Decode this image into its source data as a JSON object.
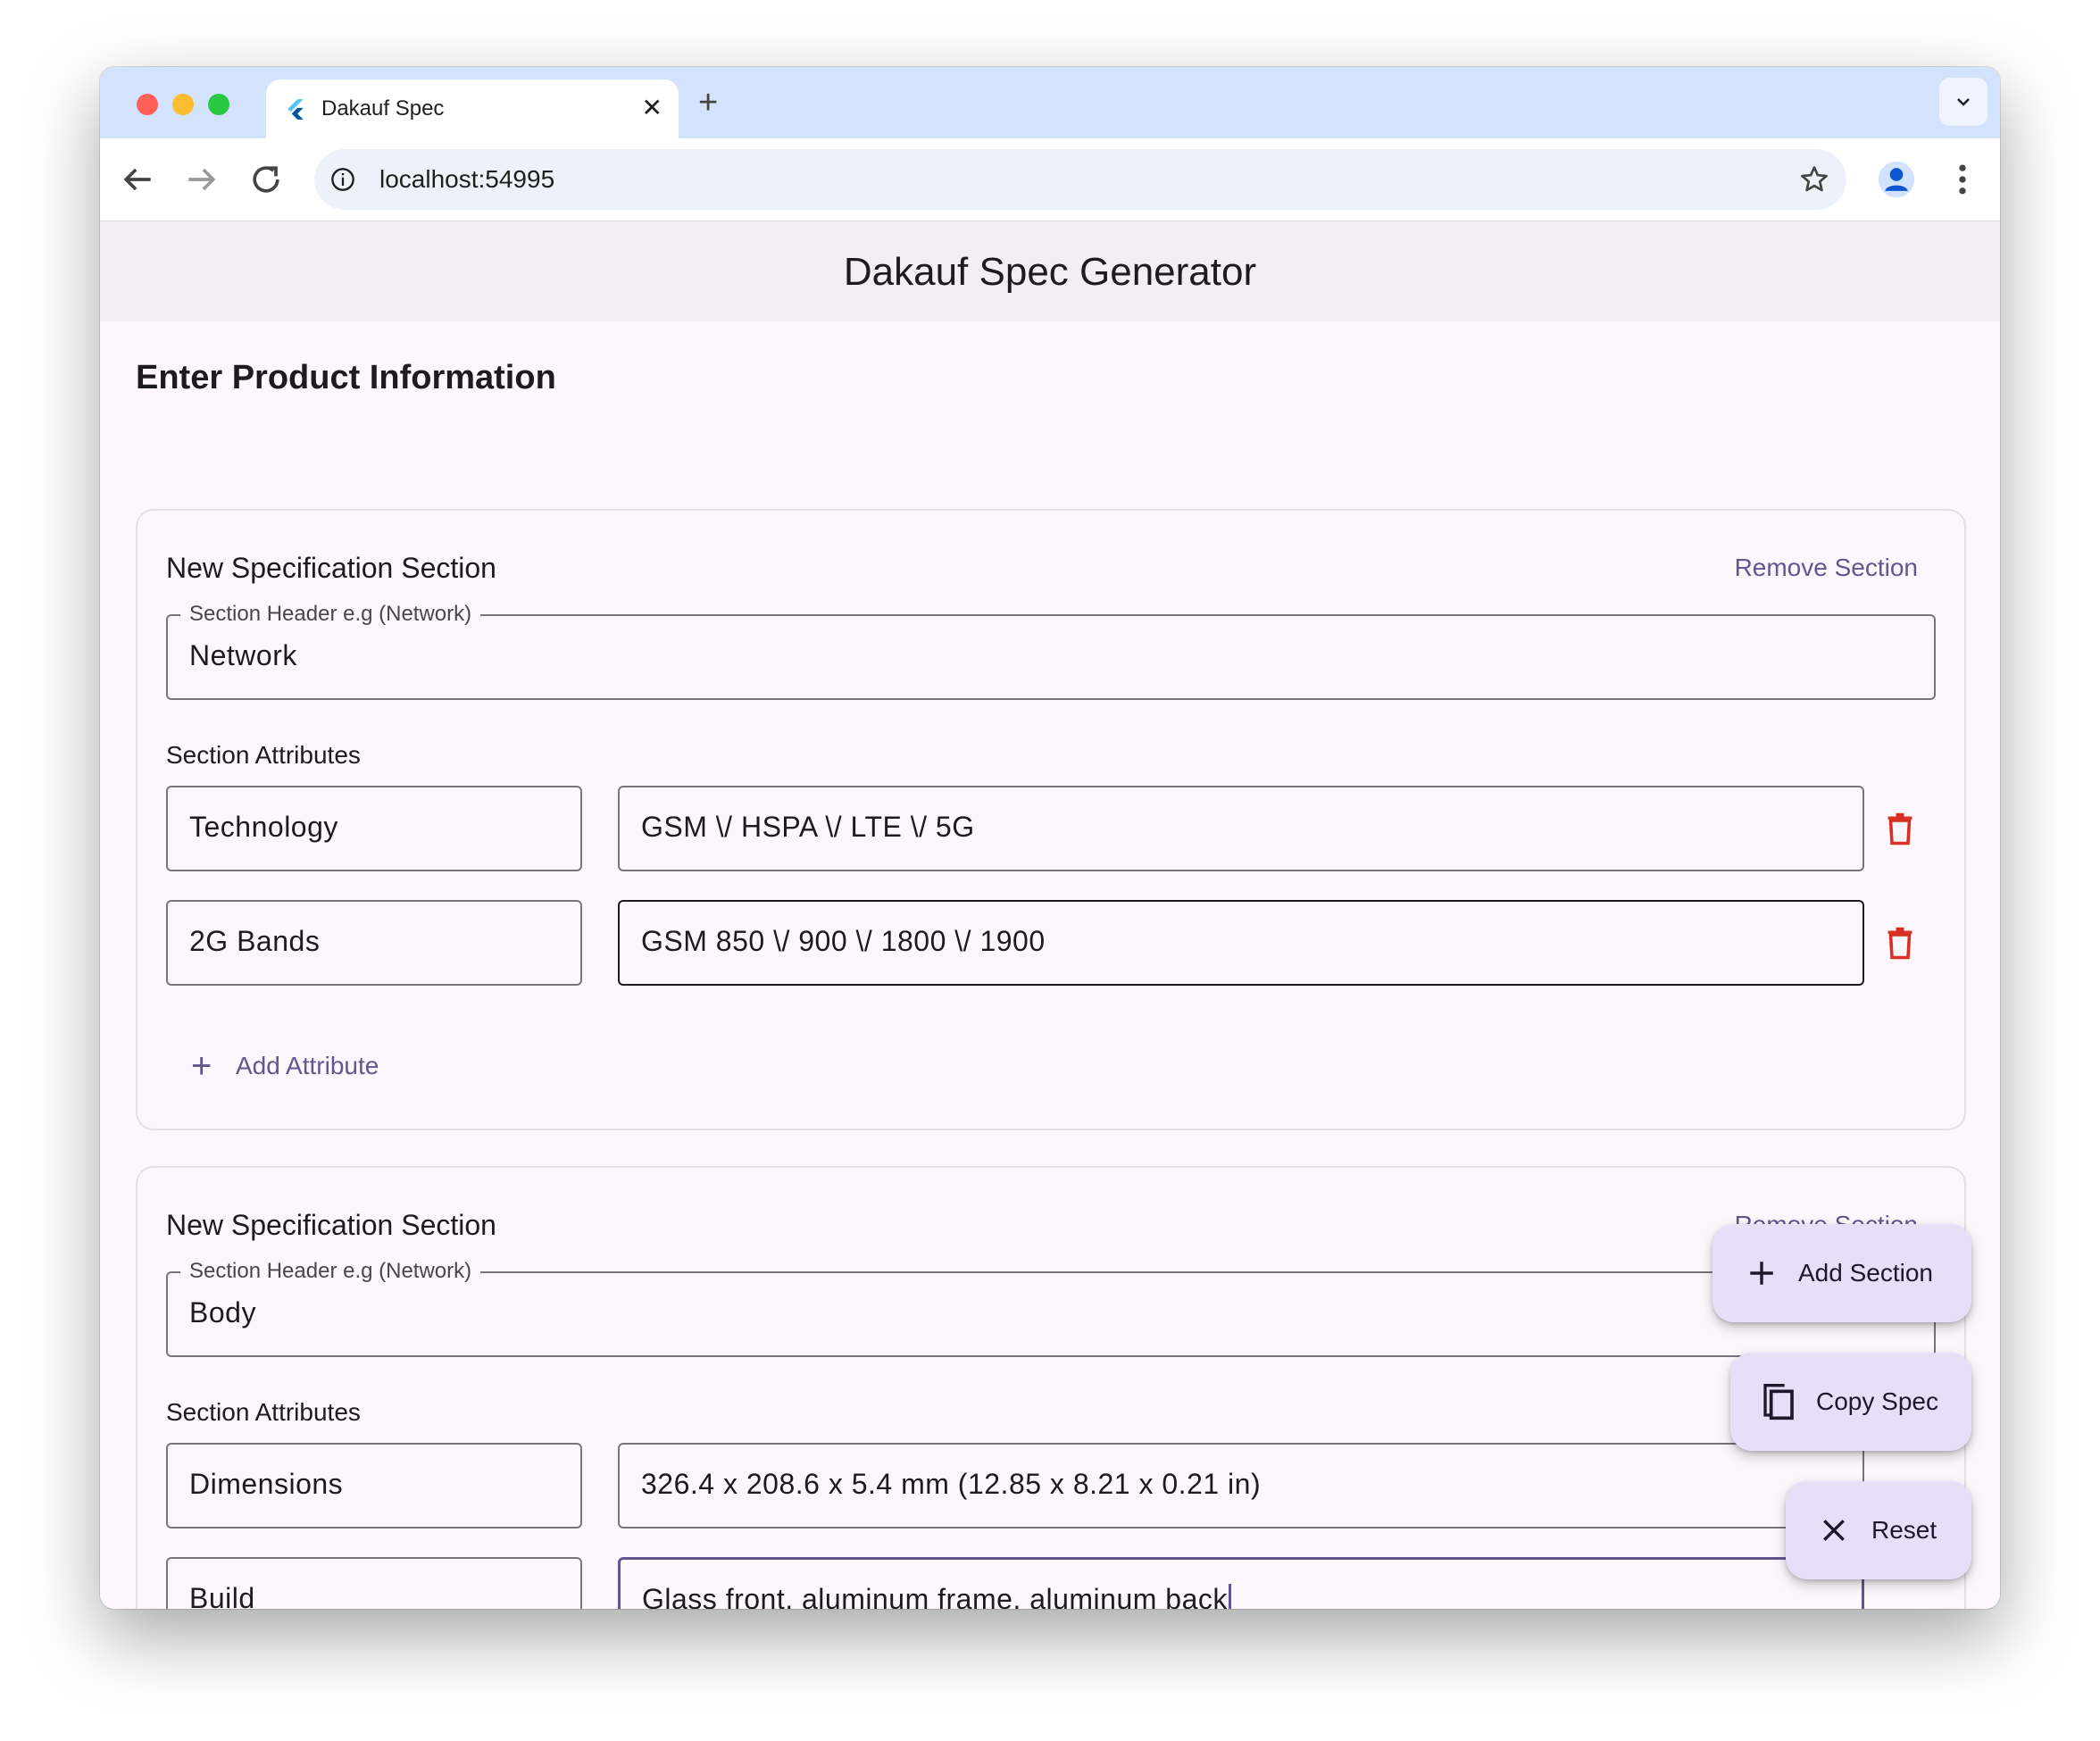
{
  "browser": {
    "tab_title": "Dakauf Spec",
    "url": "localhost:54995"
  },
  "app": {
    "title": "Dakauf Spec Generator",
    "page_heading": "Enter Product Information",
    "sections": [
      {
        "title": "New Specification Section",
        "remove_label": "Remove Section",
        "header_label": "Section Header e.g (Network)",
        "header_value": "Network",
        "attributes_label": "Section Attributes",
        "attributes": [
          {
            "name": "Technology",
            "value": "GSM \\/ HSPA \\/ LTE \\/ 5G"
          },
          {
            "name": "2G Bands",
            "value": "GSM 850 \\/ 900 \\/ 1800 \\/ 1900"
          }
        ],
        "add_attribute_label": "Add Attribute"
      },
      {
        "title": "New Specification Section",
        "remove_label": "Remove Section",
        "header_label": "Section Header e.g (Network)",
        "header_value": "Body",
        "attributes_label": "Section Attributes",
        "attributes": [
          {
            "name": "Dimensions",
            "value": "326.4 x 208.6 x 5.4 mm (12.85 x 8.21 x 0.21 in)"
          },
          {
            "name": "Build",
            "value": "Glass front, aluminum frame, aluminum back"
          }
        ]
      }
    ],
    "fabs": {
      "add_section": "Add Section",
      "copy_spec": "Copy Spec",
      "reset": "Reset"
    }
  },
  "colors": {
    "primary": "#65558f",
    "delete": "#d93025",
    "fab_bg": "#e8def8",
    "appbar_bg": "#f3eef4"
  }
}
